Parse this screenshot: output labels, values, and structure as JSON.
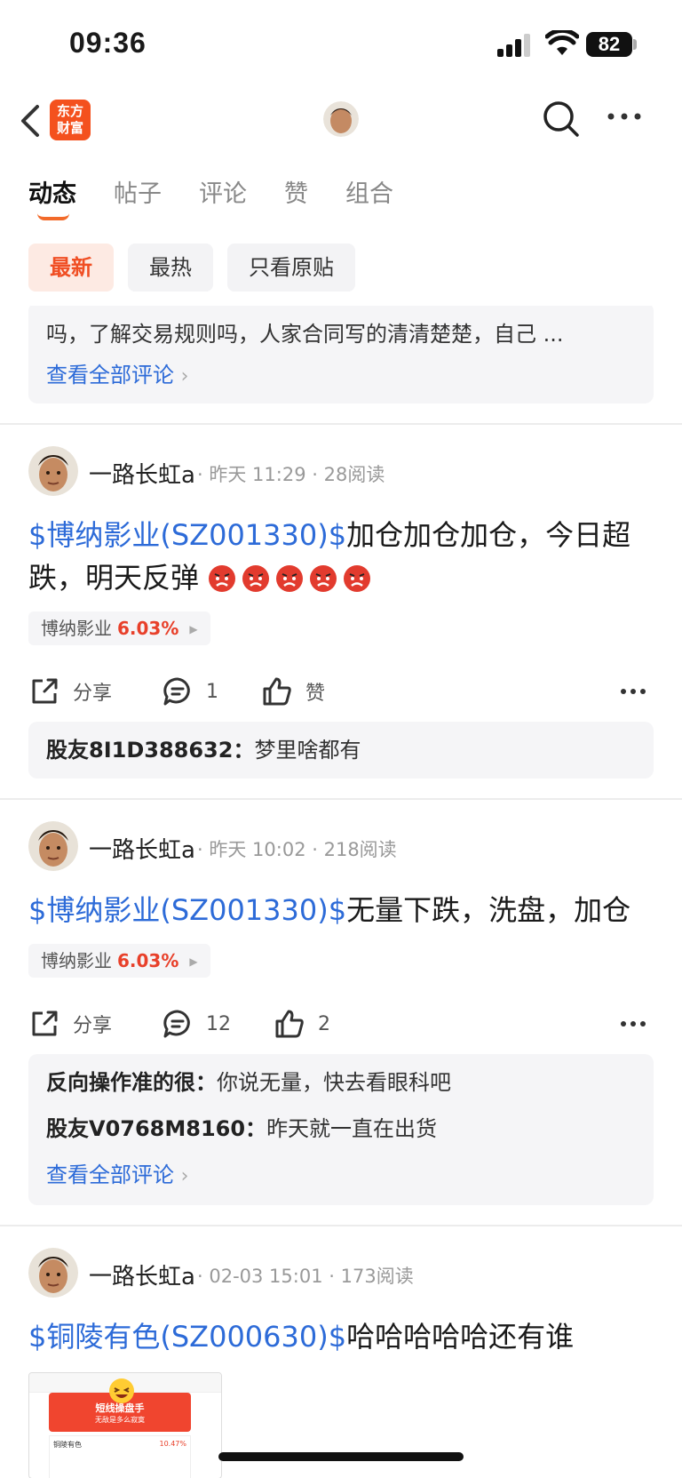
{
  "status_bar": {
    "time": "09:36",
    "battery": "82"
  },
  "header": {
    "logo_text_line1": "东方",
    "logo_text_line2": "财富"
  },
  "tabs": [
    {
      "label": "动态",
      "active": true
    },
    {
      "label": "帖子",
      "active": false
    },
    {
      "label": "评论",
      "active": false
    },
    {
      "label": "赞",
      "active": false
    },
    {
      "label": "组合",
      "active": false
    }
  ],
  "filters": [
    {
      "label": "最新",
      "active": true
    },
    {
      "label": "最热",
      "active": false
    },
    {
      "label": "只看原贴",
      "active": false
    }
  ],
  "top_partial": {
    "text": "吗，了解交易规则吗，人家合同写的清清楚楚，自己 ...",
    "see_all": "查看全部评论"
  },
  "posts": [
    {
      "author": "一路长虹a",
      "time": "昨天 11:29",
      "reads": "28阅读",
      "stock": "$博纳影业(SZ001330)$",
      "text": "加仓加仓加仓，今日超跌，明天反弹",
      "tag_name": "博纳影业",
      "tag_pct": "6.03%",
      "share": "分享",
      "comments": "1",
      "likes": "赞",
      "replies": [
        {
          "user": "股友8I1D388632：",
          "text": "梦里啥都有"
        }
      ]
    },
    {
      "author": "一路长虹a",
      "time": "昨天 10:02",
      "reads": "218阅读",
      "stock": "$博纳影业(SZ001330)$",
      "text": "无量下跌，洗盘，加仓",
      "tag_name": "博纳影业",
      "tag_pct": "6.03%",
      "share": "分享",
      "comments": "12",
      "likes": "2",
      "replies": [
        {
          "user": "反向操作准的很：",
          "text": "你说无量，快去看眼科吧"
        },
        {
          "user": "股友V0768M8160：",
          "text": "昨天就一直在出货"
        }
      ],
      "see_all": "查看全部评论"
    },
    {
      "author": "一路长虹a",
      "time": "02-03 15:01",
      "reads": "173阅读",
      "stock": "$铜陵有色(SZ000630)$",
      "text": "哈哈哈哈哈还有谁",
      "image": {
        "banner_title": "短线操盘手",
        "banner_sub": "无敌是多么寂寞",
        "stock_name": "铜陵有色",
        "stat": "10.47%"
      }
    }
  ]
}
